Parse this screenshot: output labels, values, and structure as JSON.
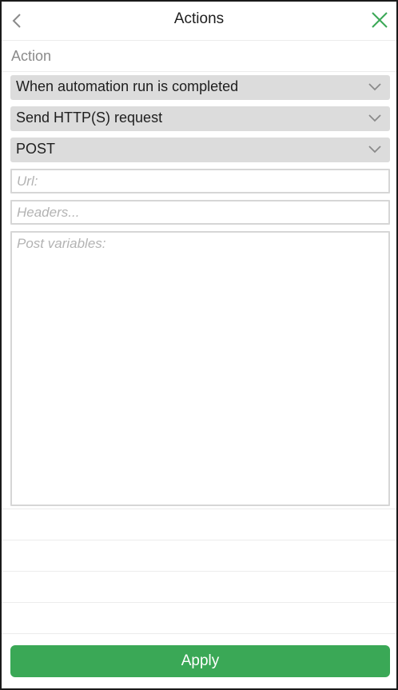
{
  "header": {
    "title": "Actions",
    "back_icon": "chevron-left-icon",
    "close_icon": "close-icon",
    "close_color": "#3aa856"
  },
  "action_section": {
    "label": "Action"
  },
  "selects": {
    "trigger": {
      "value": "When automation run is completed"
    },
    "action_type": {
      "value": "Send HTTP(S) request"
    },
    "method": {
      "value": "POST"
    }
  },
  "fields": {
    "url": {
      "placeholder": "Url:",
      "value": ""
    },
    "headers": {
      "placeholder": "Headers...",
      "value": ""
    },
    "post_variables": {
      "placeholder": "Post variables:",
      "value": ""
    }
  },
  "footer": {
    "apply_label": "Apply",
    "apply_color": "#3aa856"
  }
}
